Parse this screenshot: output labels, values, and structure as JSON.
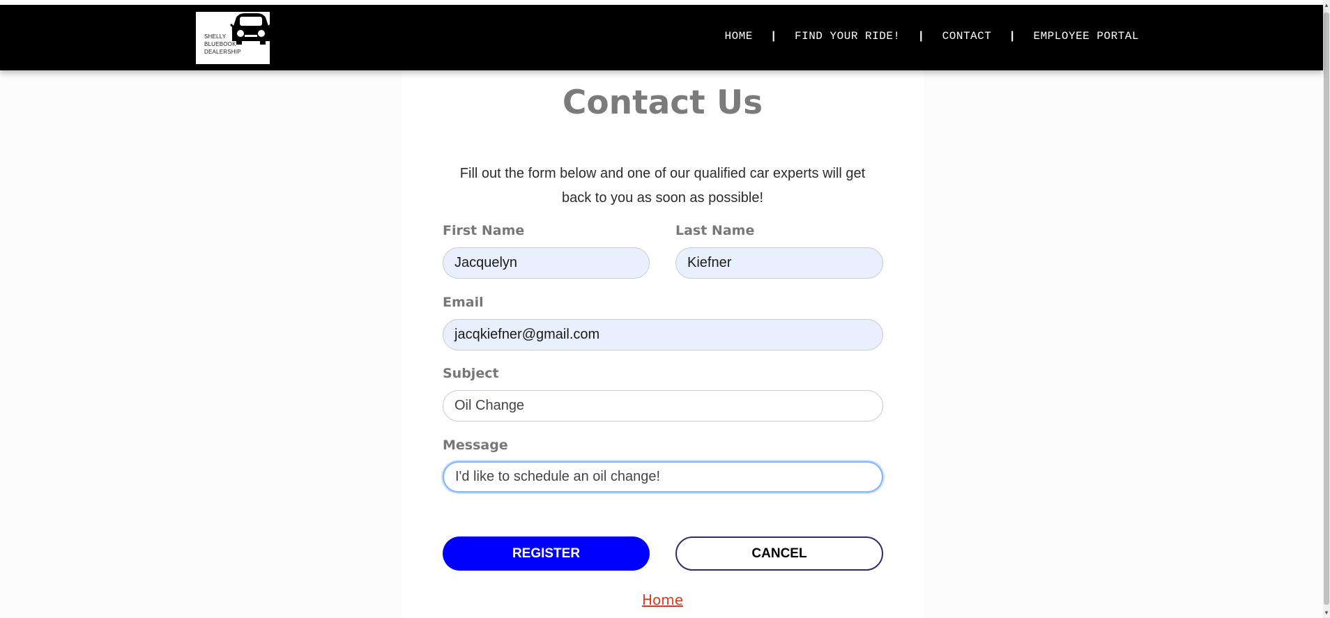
{
  "nav": {
    "logo_lines": [
      "SHELLY",
      "BLUEBOOK",
      "DEALERSHIP"
    ],
    "links": [
      "HOME",
      "FIND YOUR RIDE!",
      "CONTACT",
      "EMPLOYEE PORTAL"
    ],
    "separator": "|"
  },
  "page": {
    "title": "Contact Us",
    "intro": "Fill out the form below and one of our qualified car experts will get back to you as soon as possible!"
  },
  "form": {
    "first_name": {
      "label": "First Name",
      "value": "Jacquelyn"
    },
    "last_name": {
      "label": "Last Name",
      "value": "Kiefner"
    },
    "email": {
      "label": "Email",
      "value": "jacqkiefner@gmail.com"
    },
    "subject": {
      "label": "Subject",
      "value": "Oil Change"
    },
    "message": {
      "label": "Message",
      "value": "I'd like to schedule an oil change!"
    },
    "register_label": "REGISTER",
    "cancel_label": "CANCEL",
    "home_link": "Home"
  },
  "colors": {
    "navbar": "#000000",
    "register_button": "#0000ff",
    "autofill_field": "#e8f0fe",
    "home_link": "#e03a1e"
  }
}
